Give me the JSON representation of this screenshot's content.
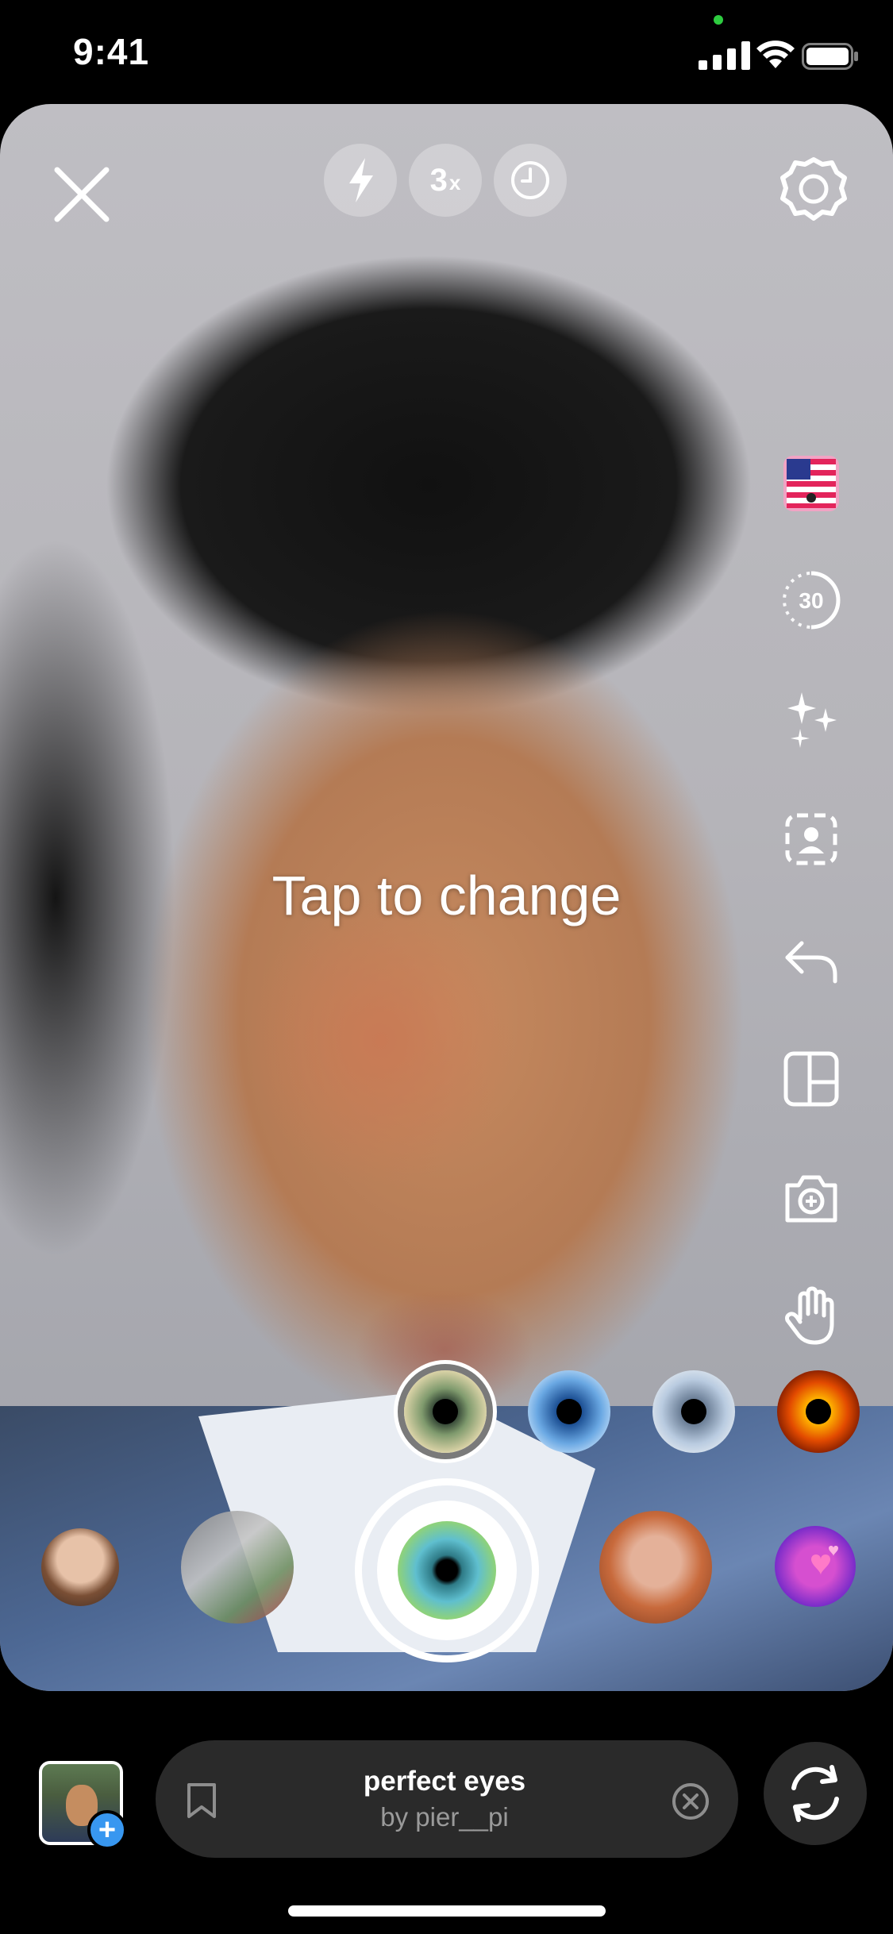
{
  "status_bar": {
    "time": "9:41"
  },
  "top_controls": {
    "zoom_label": "3",
    "zoom_suffix": "x"
  },
  "side_tools": {
    "timer_value": "30"
  },
  "hint": "Tap to change",
  "eye_options": [
    {
      "name": "green-hazel",
      "colors": [
        "#2a3b2e",
        "#7f9a6d",
        "#d9d2a6"
      ],
      "selected": true
    },
    {
      "name": "blue",
      "colors": [
        "#1c4f93",
        "#6aa8e3",
        "#cfe6fb"
      ]
    },
    {
      "name": "grey-blue",
      "colors": [
        "#6b7e96",
        "#b9cbe0",
        "#e9eef3"
      ]
    },
    {
      "name": "fire",
      "colors": [
        "#1a0500",
        "#e24a00",
        "#ffb200"
      ]
    }
  ],
  "effect": {
    "name": "perfect eyes",
    "author": "by pier__pi"
  },
  "colors": {
    "accent_blue": "#3897f0",
    "pill_bg": "#2a2a2a"
  }
}
